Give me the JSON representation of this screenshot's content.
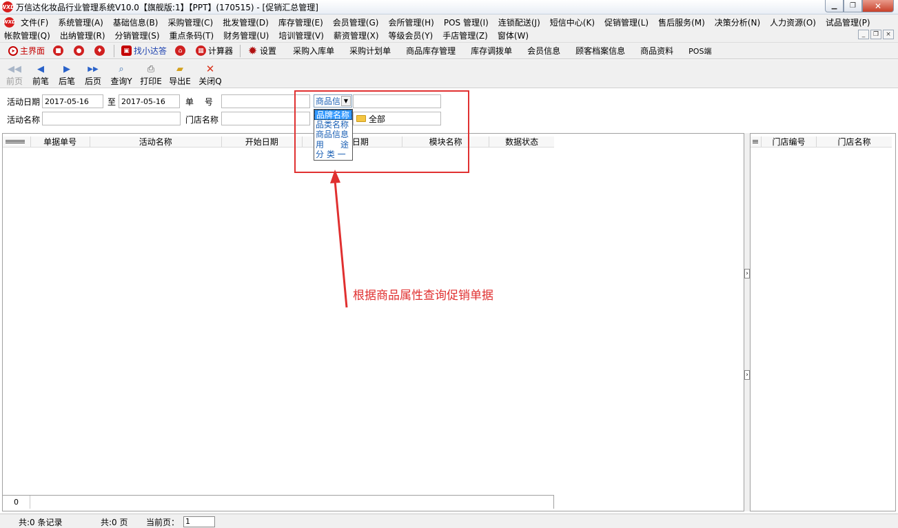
{
  "window": {
    "logo": "WXD",
    "title": "万信达化妆品行业管理系统V10.0【旗舰版:1】【PPT】(170515) - [促销汇总管理]",
    "min_label": "▁",
    "max_label": "❐",
    "close_label": "✕"
  },
  "menu": {
    "row1": [
      "文件(F)",
      "系统管理(A)",
      "基础信息(B)",
      "采购管理(C)",
      "批发管理(D)",
      "库存管理(E)",
      "会员管理(G)",
      "会所管理(H)",
      "POS 管理(I)",
      "连锁配送(J)",
      "短信中心(K)",
      "促销管理(L)",
      "售后服务(M)",
      "决策分析(N)",
      "人力资源(O)",
      "试品管理(P)"
    ],
    "row2": [
      "帐款管理(Q)",
      "出纳管理(R)",
      "分销管理(S)",
      "重点条码(T)",
      "财务管理(U)",
      "培训管理(V)",
      "薪资管理(X)",
      "等级会员(Y)",
      "手店管理(Z)",
      "窗体(W)"
    ],
    "mdi_min": "_",
    "mdi_restore": "❐",
    "mdi_close": "×"
  },
  "quickbar": {
    "home": "主界面",
    "assistant": "找小达答",
    "calculator": "计算器",
    "settings": "设置",
    "links": [
      "采购入库单",
      "采购计划单",
      "商品库存管理",
      "库存调拨单",
      "会员信息",
      "顾客档案信息",
      "商品资料",
      "POS端"
    ]
  },
  "nav": {
    "prev_page": "前页",
    "prev_record": "前笔",
    "next_record": "后笔",
    "next_page": "后页",
    "query": "查询Y",
    "print": "打印E",
    "export": "导出E",
    "close": "关闭Q"
  },
  "filter": {
    "date_label": "活动日期",
    "date_from": "2017-05-16",
    "to_label": "至",
    "date_to": "2017-05-16",
    "doc_no_label": "单　 号",
    "doc_no_value": "",
    "activity_name_label": "活动名称",
    "activity_name_value": "",
    "store_name_label": "门店名称",
    "store_name_value": "",
    "attr_select_value": "商品信",
    "attr_value": "",
    "attr_options": [
      "品牌名称",
      "品类名称",
      "商品信息",
      "用　　途",
      "分 类 一"
    ],
    "tree_value": "全部"
  },
  "grid_main": {
    "columns": [
      "单据单号",
      "活动名称",
      "开始日期",
      "结束日期",
      "模块名称",
      "数据状态"
    ],
    "footer_count": "0"
  },
  "grid_right": {
    "columns": [
      "门店编号",
      "门店名称"
    ]
  },
  "status": {
    "records": "共:0 条记录",
    "pages": "共:0 页",
    "current_page_label": "当前页：",
    "current_page_value": "1"
  },
  "annotation": {
    "text": "根据商品属性查询促销单据",
    "color": "#e03030"
  }
}
